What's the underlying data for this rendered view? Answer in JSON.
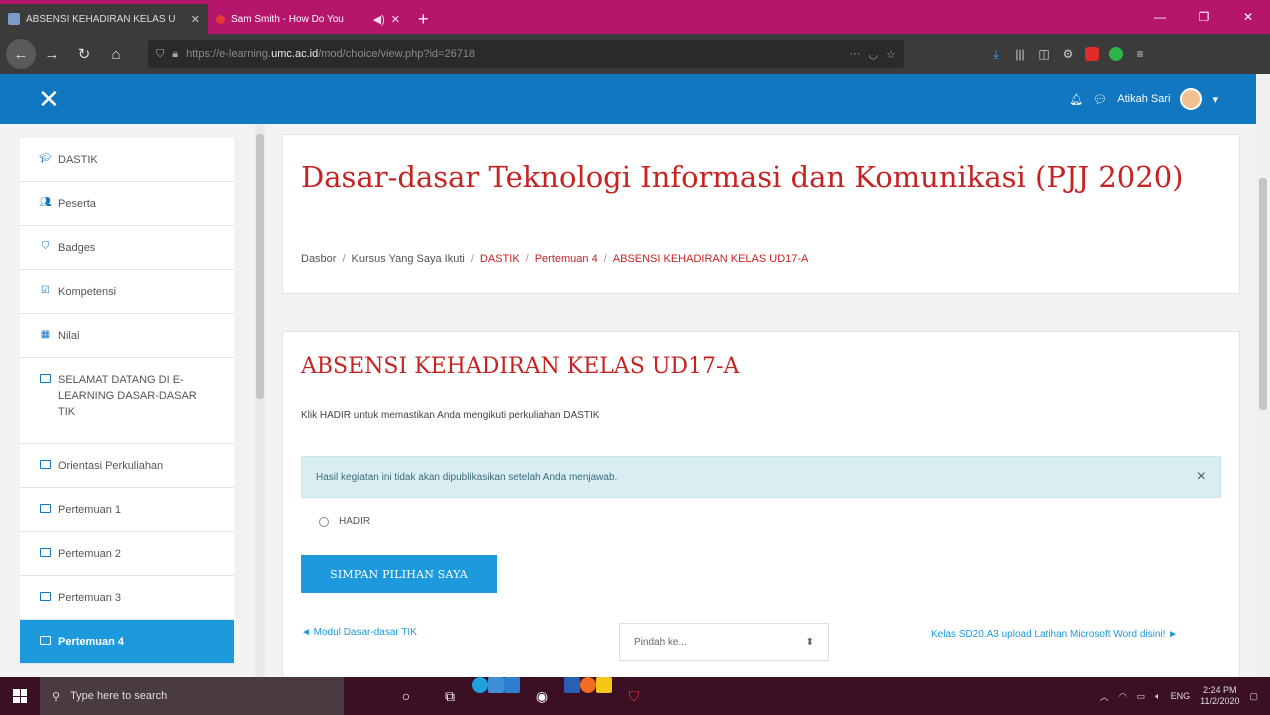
{
  "browser": {
    "tabs": [
      {
        "title": "ABSENSI KEHADIRAN KELAS U",
        "active": true
      },
      {
        "title": "Sam Smith - How Do You",
        "active": false
      }
    ],
    "new_tab": "+",
    "url_prefix": "https://e-learning.",
    "url_domain": "umc.ac.id",
    "url_path": "/mod/choice/view.php?id=26718",
    "page_actions": "···"
  },
  "navbar": {
    "user_name": "Atikah Sari"
  },
  "sidebar": {
    "items": [
      {
        "label": "DASTIK",
        "icon": "graduation-cap-icon"
      },
      {
        "label": "Peserta",
        "icon": "users-icon"
      },
      {
        "label": "Badges",
        "icon": "shield-icon"
      },
      {
        "label": "Kompetensi",
        "icon": "check-square-icon"
      },
      {
        "label": "Nilai",
        "icon": "table-icon"
      },
      {
        "label": "SELAMAT DATANG DI E-LEARNING DASAR-DASAR TIK",
        "icon": "folder-icon"
      },
      {
        "label": "Orientasi Perkuliahan",
        "icon": "folder-icon"
      },
      {
        "label": "Pertemuan 1",
        "icon": "folder-icon"
      },
      {
        "label": "Pertemuan 2",
        "icon": "folder-icon"
      },
      {
        "label": "Pertemuan 3",
        "icon": "folder-icon"
      },
      {
        "label": "Pertemuan 4",
        "icon": "folder-icon",
        "active": true
      }
    ]
  },
  "header": {
    "title": "Dasar-dasar Teknologi Informasi dan Komunikasi (PJJ 2020)",
    "breadcrumb": [
      "Dasbor",
      "Kursus Yang Saya Ikuti",
      "DASTIK",
      "Pertemuan 4",
      "ABSENSI KEHADIRAN KELAS UD17-A"
    ],
    "separator": "/"
  },
  "activity": {
    "title": "ABSENSI KEHADIRAN KELAS UD17-A",
    "intro": "Klik HADIR untuk memastikan Anda mengikuti perkuliahan DASTIK",
    "alert": "Hasil kegiatan ini tidak akan dipublikasikan setelah Anda menjawab.",
    "alert_close": "×",
    "option_label": "HADIR",
    "submit_label": "SIMPAN PILIHAN SAYA",
    "prev_link": "◄ Modul Dasar-dasar TIK",
    "jump_placeholder": "Pindah ke...",
    "next_link": "Kelas SD20.A3 upload Latihan Microsoft Word disini! ►"
  },
  "taskbar": {
    "search_placeholder": "Type here to search",
    "language": "ENG",
    "time": "2:24 PM",
    "date": "11/2/2020"
  }
}
